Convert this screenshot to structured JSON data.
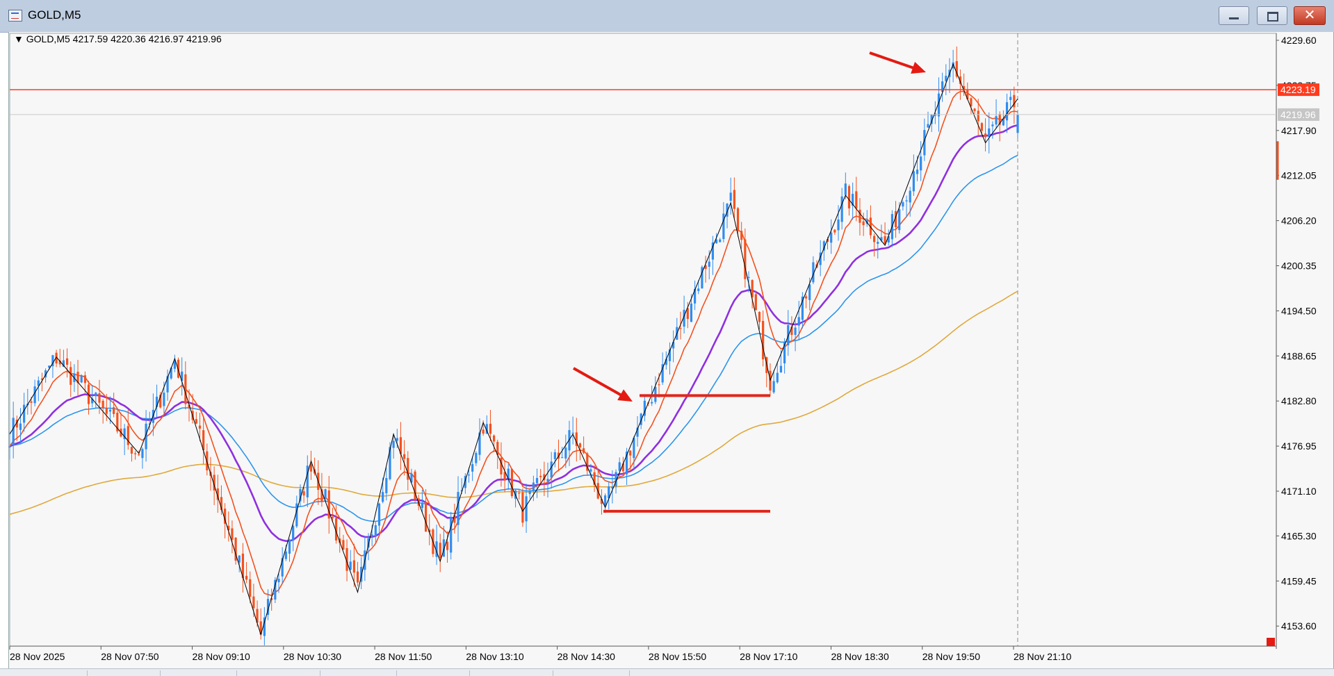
{
  "window": {
    "title": "GOLD,M5"
  },
  "info_line": "GOLD,M5  4217.59 4220.36 4216.97 4219.96",
  "price_scale": {
    "labels": [
      "4229.60",
      "4223.75",
      "4217.90",
      "4212.05",
      "4206.20",
      "4200.35",
      "4194.50",
      "4188.65",
      "4182.80",
      "4176.95",
      "4171.10",
      "4165.30",
      "4159.45",
      "4153.60"
    ],
    "current_price": "4219.96",
    "hline_price": "4223.19",
    "hline_color": "#ff3b1f"
  },
  "time_axis": {
    "labels": [
      "28 Nov 2025",
      "28 Nov 07:50",
      "28 Nov 09:10",
      "28 Nov 10:30",
      "28 Nov 11:50",
      "28 Nov 13:10",
      "28 Nov 14:30",
      "28 Nov 15:50",
      "28 Nov 17:10",
      "28 Nov 18:30",
      "28 Nov 19:50",
      "28 Nov 21:10"
    ]
  },
  "colors": {
    "bull": "#2f8cf0",
    "bear": "#f4511e",
    "ma_fast": "#f4511e",
    "ma_purple": "#8f2fe0",
    "ma_blue": "#2b95ee",
    "ma_gold": "#e0a93a"
  },
  "chart_data": {
    "type": "candlestick",
    "symbol": "GOLD",
    "timeframe": "M5",
    "last": {
      "open": 4217.59,
      "high": 4220.36,
      "low": 4216.97,
      "close": 4219.96
    },
    "ylim": [
      4151.0,
      4230.5
    ],
    "zigzag_prices": [
      4178.5,
      4188.5,
      4176,
      4188.3,
      4152.5,
      4175,
      4158,
      4178.5,
      4162,
      4180,
      4168.5,
      4178.5,
      4169,
      4208.5,
      4185.5,
      4209.5,
      4203,
      4226.5,
      4216.3,
      4222
    ],
    "horizontal_lines": [
      4223.19,
      4219.96
    ],
    "support_resistance": [
      4183.5,
      4168.5
    ],
    "annotation_arrows": 2
  },
  "icons": {
    "app": "chart-icon",
    "minimize": "minimize-icon",
    "maximize": "maximize-icon",
    "close": "close-icon"
  }
}
